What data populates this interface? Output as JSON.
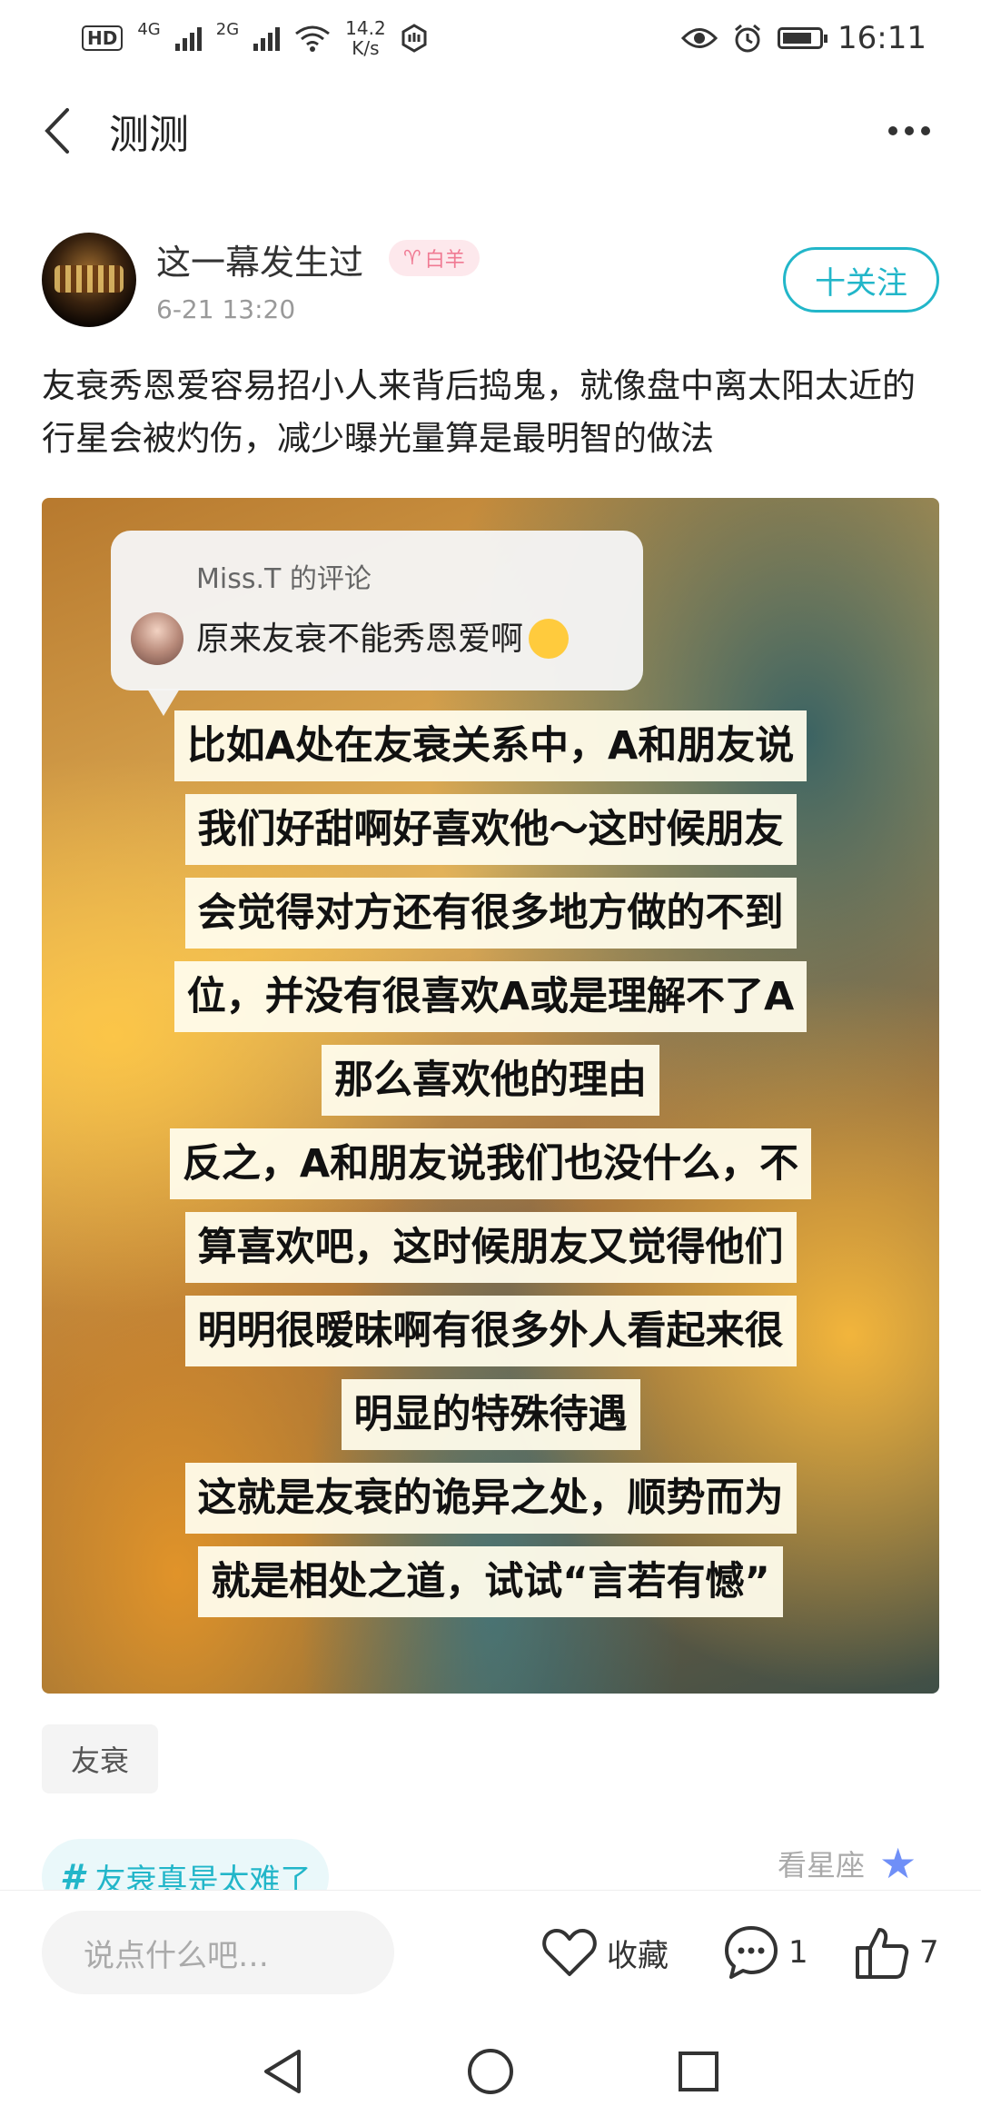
{
  "status_bar": {
    "hd": "HD",
    "sim1_type": "4G",
    "sim2_type": "2G",
    "speed_value": "14.2",
    "speed_unit": "K/s",
    "time": "16:11",
    "icons": [
      "hd-icon",
      "signal-icon",
      "wifi-icon",
      "nfc-icon",
      "eye-icon",
      "alarm-icon",
      "battery-icon"
    ]
  },
  "nav": {
    "title": "测测"
  },
  "post": {
    "author_name": "这一幕发生过",
    "zodiac_symbol": "♈",
    "zodiac_label": "白羊",
    "time": "6-21 13:20",
    "follow_label": "十关注",
    "text": "友衰秀恩爱容易招小人来背后捣鬼，就像盘中离太阳太近的行星会被灼伤，减少曝光量算是最明智的做法",
    "image": {
      "comment_header": "Miss.T 的评论",
      "comment_text": "原来友衰不能秀恩爱啊",
      "lines": [
        "比如A处在友衰关系中，A和朋友说",
        "我们好甜啊好喜欢他～这时候朋友",
        "会觉得对方还有很多地方做的不到",
        "位，并没有很喜欢A或是理解不了A",
        "那么喜欢他的理由",
        "反之，A和朋友说我们也没什么，不",
        "算喜欢吧，这时候朋友又觉得他们",
        "明明很暧昧啊有很多外人看起来很",
        "明显的特殊待遇",
        "这就是友衰的诡异之处，顺势而为",
        "就是相处之道，试试“言若有憾”"
      ]
    },
    "tag": "友衰",
    "topic": "友衰真是太难了",
    "topic_hash": "#",
    "watch_zodiac": "看星座"
  },
  "bottom": {
    "input_placeholder": "说点什么吧…",
    "favorite_label": "收藏",
    "comment_count": "1",
    "like_count": "7"
  },
  "colors": {
    "accent": "#22b6c9",
    "zodiac_pink": "#f07a93"
  }
}
